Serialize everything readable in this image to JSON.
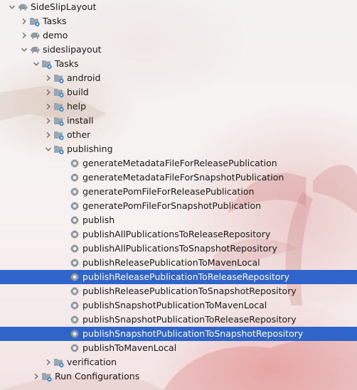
{
  "tree": {
    "root": {
      "label": "SideSlipLayout",
      "icon": "gradle-elephant-icon"
    },
    "root_tasks": {
      "label": "Tasks",
      "icon": "folder-gear-icon"
    },
    "demo": {
      "label": "demo",
      "icon": "gradle-elephant-icon"
    },
    "sideslip": {
      "label": "sideslipayout",
      "icon": "gradle-elephant-icon"
    },
    "sideslip_tasks": {
      "label": "Tasks",
      "icon": "folder-gear-icon"
    },
    "groups": [
      {
        "label": "android"
      },
      {
        "label": "build"
      },
      {
        "label": "help"
      },
      {
        "label": "install"
      },
      {
        "label": "other"
      }
    ],
    "publishing": {
      "label": "publishing",
      "tasks": [
        {
          "label": "generateMetadataFileForReleasePublication",
          "selected": false
        },
        {
          "label": "generateMetadataFileForSnapshotPublication",
          "selected": false
        },
        {
          "label": "generatePomFileForReleasePublication",
          "selected": false
        },
        {
          "label": "generatePomFileForSnapshotPublication",
          "selected": false
        },
        {
          "label": "publish",
          "selected": false
        },
        {
          "label": "publishAllPublicationsToReleaseRepository",
          "selected": false
        },
        {
          "label": "publishAllPublicationsToSnapshotRepository",
          "selected": false
        },
        {
          "label": "publishReleasePublicationToMavenLocal",
          "selected": false
        },
        {
          "label": "publishReleasePublicationToReleaseRepository",
          "selected": true
        },
        {
          "label": "publishReleasePublicationToSnapshotRepository",
          "selected": false
        },
        {
          "label": "publishSnapshotPublicationToMavenLocal",
          "selected": false
        },
        {
          "label": "publishSnapshotPublicationToReleaseRepository",
          "selected": false
        },
        {
          "label": "publishSnapshotPublicationToSnapshotRepository",
          "selected": true
        },
        {
          "label": "publishToMavenLocal",
          "selected": false
        }
      ]
    },
    "verification": {
      "label": "verification"
    },
    "run_configurations": {
      "label": "Run Configurations",
      "icon": "folder-gear-icon"
    }
  },
  "colors": {
    "selection": "#2f65ca",
    "folder": "#9aa7b0",
    "gear_blue": "#3c8fd6",
    "arrow": "#6e6e6e"
  }
}
